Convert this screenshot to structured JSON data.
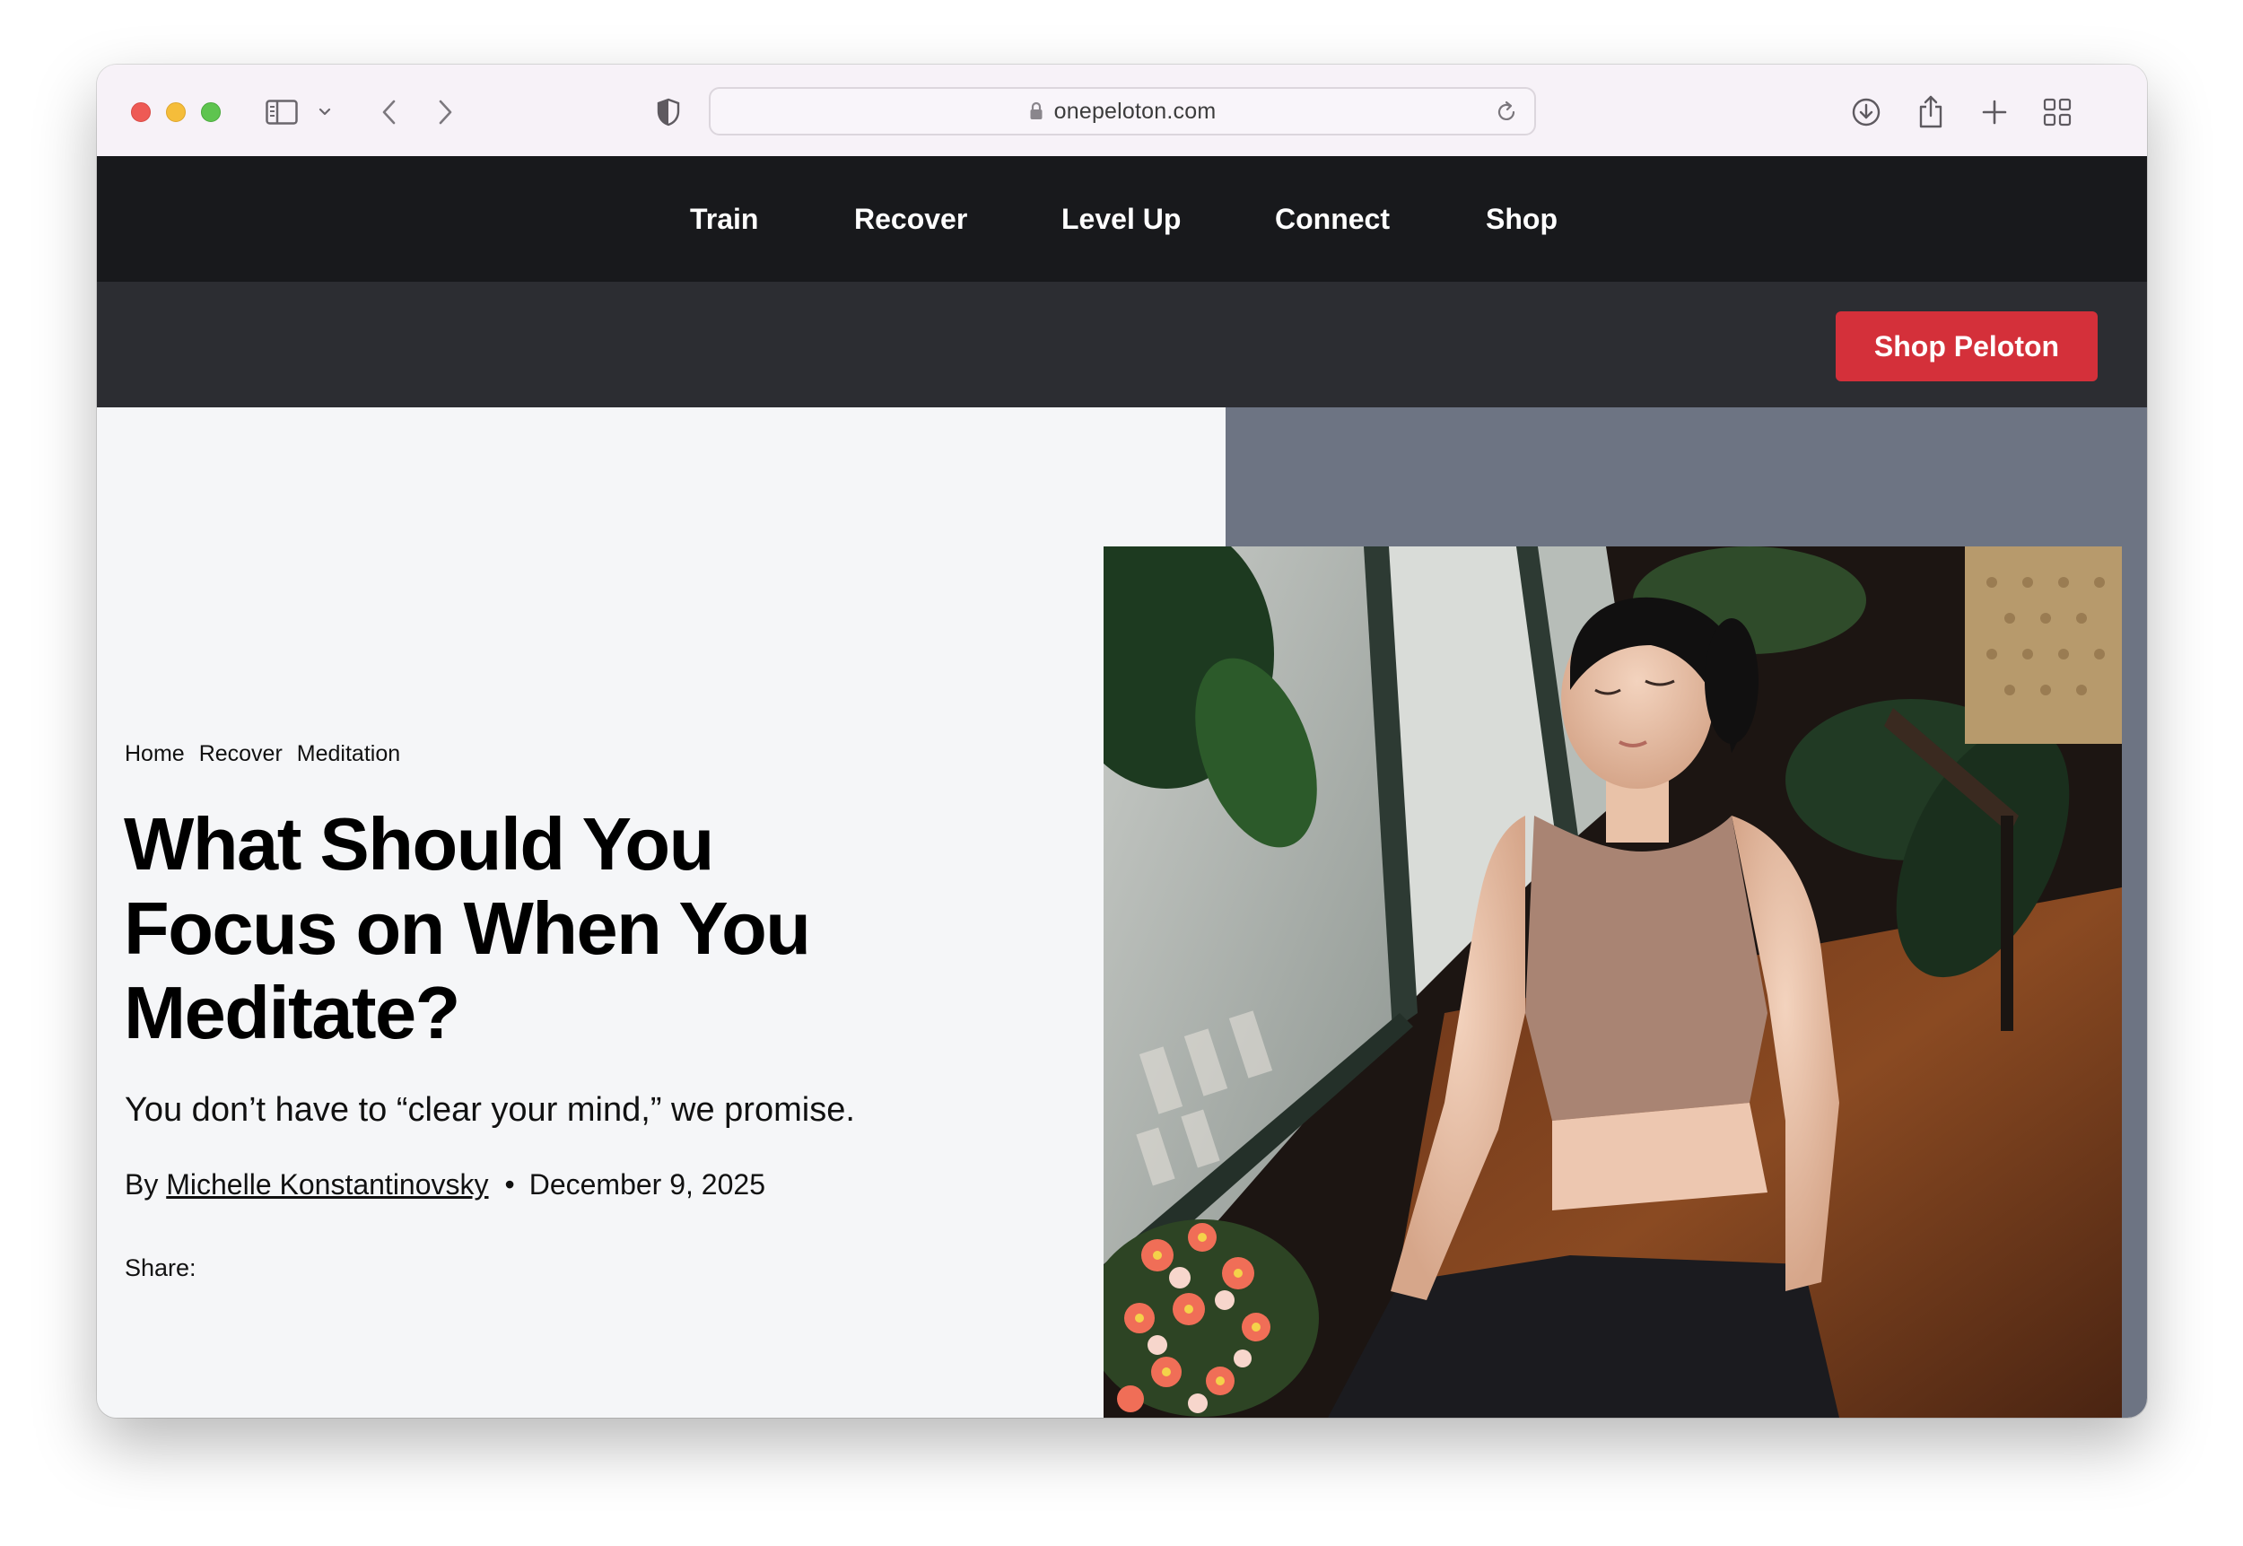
{
  "browser": {
    "url": "onepeloton.com"
  },
  "nav": {
    "items": [
      {
        "label": "Train"
      },
      {
        "label": "Recover"
      },
      {
        "label": "Level Up"
      },
      {
        "label": "Connect"
      },
      {
        "label": "Shop"
      }
    ],
    "cta": "Shop Peloton"
  },
  "article": {
    "breadcrumb": [
      "Home",
      "Recover",
      "Meditation"
    ],
    "title": "What Should You Focus on When You Meditate?",
    "dek": "You don’t have to “clear your mind,” we promise.",
    "byline_prefix": "By ",
    "author": "Michelle Konstantinovsky",
    "separator": "•",
    "date": "December 9, 2025",
    "share_label": "Share:"
  },
  "colors": {
    "nav_bg": "#18191c",
    "subbar_bg": "#2c2d32",
    "cta_bg": "#d4303a",
    "hero_bg": "#f5f6f8",
    "hero_slate": "#6d7483"
  }
}
